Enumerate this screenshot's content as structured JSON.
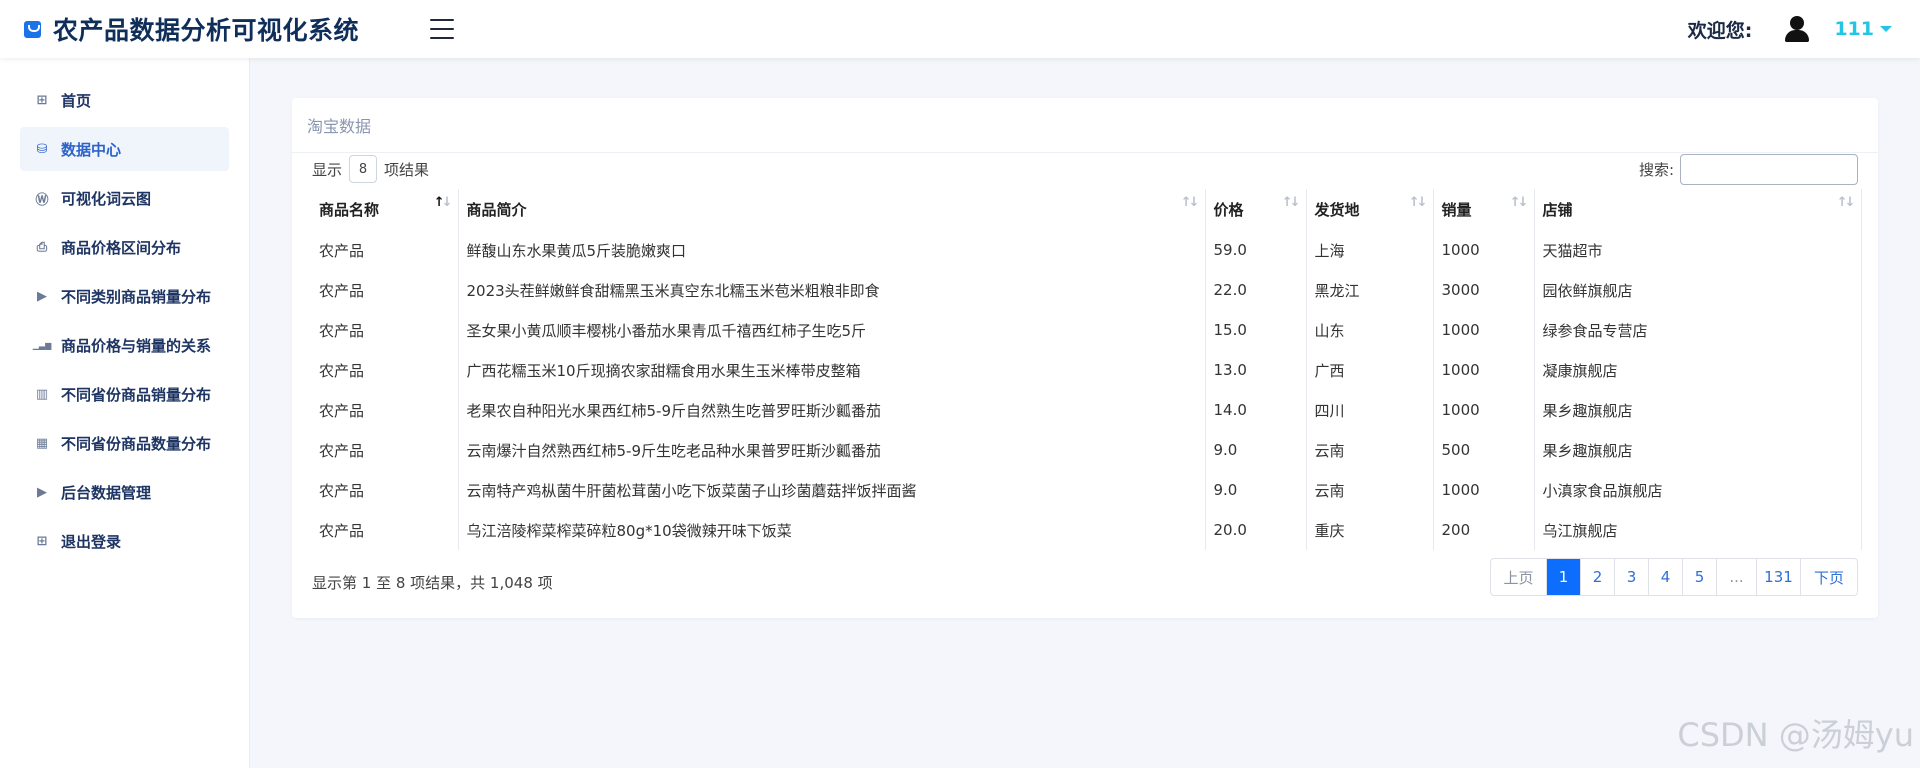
{
  "app": {
    "title": "农产品数据分析可视化系统"
  },
  "header": {
    "welcome": "欢迎您:",
    "username": "111"
  },
  "sidebar": {
    "items": [
      {
        "label": "首页",
        "icon": "grid-icon",
        "glyph": "⊞"
      },
      {
        "label": "数据中心",
        "icon": "database-icon",
        "glyph": "⛁"
      },
      {
        "label": "可视化词云图",
        "icon": "wordpress-icon",
        "glyph": "Ⓦ"
      },
      {
        "label": "商品价格区间分布",
        "icon": "printer-icon",
        "glyph": "⎙"
      },
      {
        "label": "不同类别商品销量分布",
        "icon": "play-icon",
        "glyph": "▶"
      },
      {
        "label": "商品价格与销量的关系",
        "icon": "bar-chart-icon",
        "glyph": "▁▃▆"
      },
      {
        "label": "不同省份商品销量分布",
        "icon": "map-icon",
        "glyph": "▥"
      },
      {
        "label": "不同省份商品数量分布",
        "icon": "map-filled-icon",
        "glyph": "▦"
      },
      {
        "label": "后台数据管理",
        "icon": "play-icon",
        "glyph": "▶"
      },
      {
        "label": "退出登录",
        "icon": "grid-icon",
        "glyph": "⊞"
      }
    ]
  },
  "card": {
    "title": "淘宝数据",
    "length": {
      "prefix": "显示",
      "value": "8",
      "suffix": "项结果"
    },
    "search": {
      "label": "搜索:",
      "value": ""
    }
  },
  "table": {
    "columns": [
      "商品名称",
      "商品简介",
      "价格",
      "发货地",
      "销量",
      "店铺"
    ],
    "rows": [
      [
        "农产品",
        "鲜馥山东水果黄瓜5斤装脆嫩爽口",
        "59.0",
        "上海",
        "1000",
        "天猫超市"
      ],
      [
        "农产品",
        "2023头茬鲜嫩鲜食甜糯黑玉米真空东北糯玉米苞米粗粮非即食",
        "22.0",
        "黑龙江",
        "3000",
        "园依鲜旗舰店"
      ],
      [
        "农产品",
        "圣女果小黄瓜顺丰樱桃小番茄水果青瓜千禧西红柿子生吃5斤",
        "15.0",
        "山东",
        "1000",
        "绿参食品专营店"
      ],
      [
        "农产品",
        "广西花糯玉米10斤现摘农家甜糯食用水果生玉米棒带皮整箱",
        "13.0",
        "广西",
        "1000",
        "凝康旗舰店"
      ],
      [
        "农产品",
        "老果农自种阳光水果西红柿5-9斤自然熟生吃普罗旺斯沙瓤番茄",
        "14.0",
        "四川",
        "1000",
        "果乡趣旗舰店"
      ],
      [
        "农产品",
        "云南爆汁自然熟西红柿5-9斤生吃老品种水果普罗旺斯沙瓤番茄",
        "9.0",
        "云南",
        "500",
        "果乡趣旗舰店"
      ],
      [
        "农产品",
        "云南特产鸡枞菌牛肝菌松茸菌小吃下饭菜菌子山珍菌蘑菇拌饭拌面酱",
        "9.0",
        "云南",
        "1000",
        "小滇家食品旗舰店"
      ],
      [
        "农产品",
        "乌江涪陵榨菜榨菜碎粒80g*10袋微辣开味下饭菜",
        "20.0",
        "重庆",
        "200",
        "乌江旗舰店"
      ]
    ]
  },
  "footer": {
    "info": "显示第 1 至 8 项结果，共 1,048 项",
    "pages": [
      "上页",
      "1",
      "2",
      "3",
      "4",
      "5",
      "...",
      "131",
      "下页"
    ],
    "active_page": "1"
  },
  "watermark": "CSDN @汤姆yu",
  "colors": {
    "accent": "#0d6efd",
    "username": "#22c5e6",
    "brand": "#0f2f5a"
  }
}
